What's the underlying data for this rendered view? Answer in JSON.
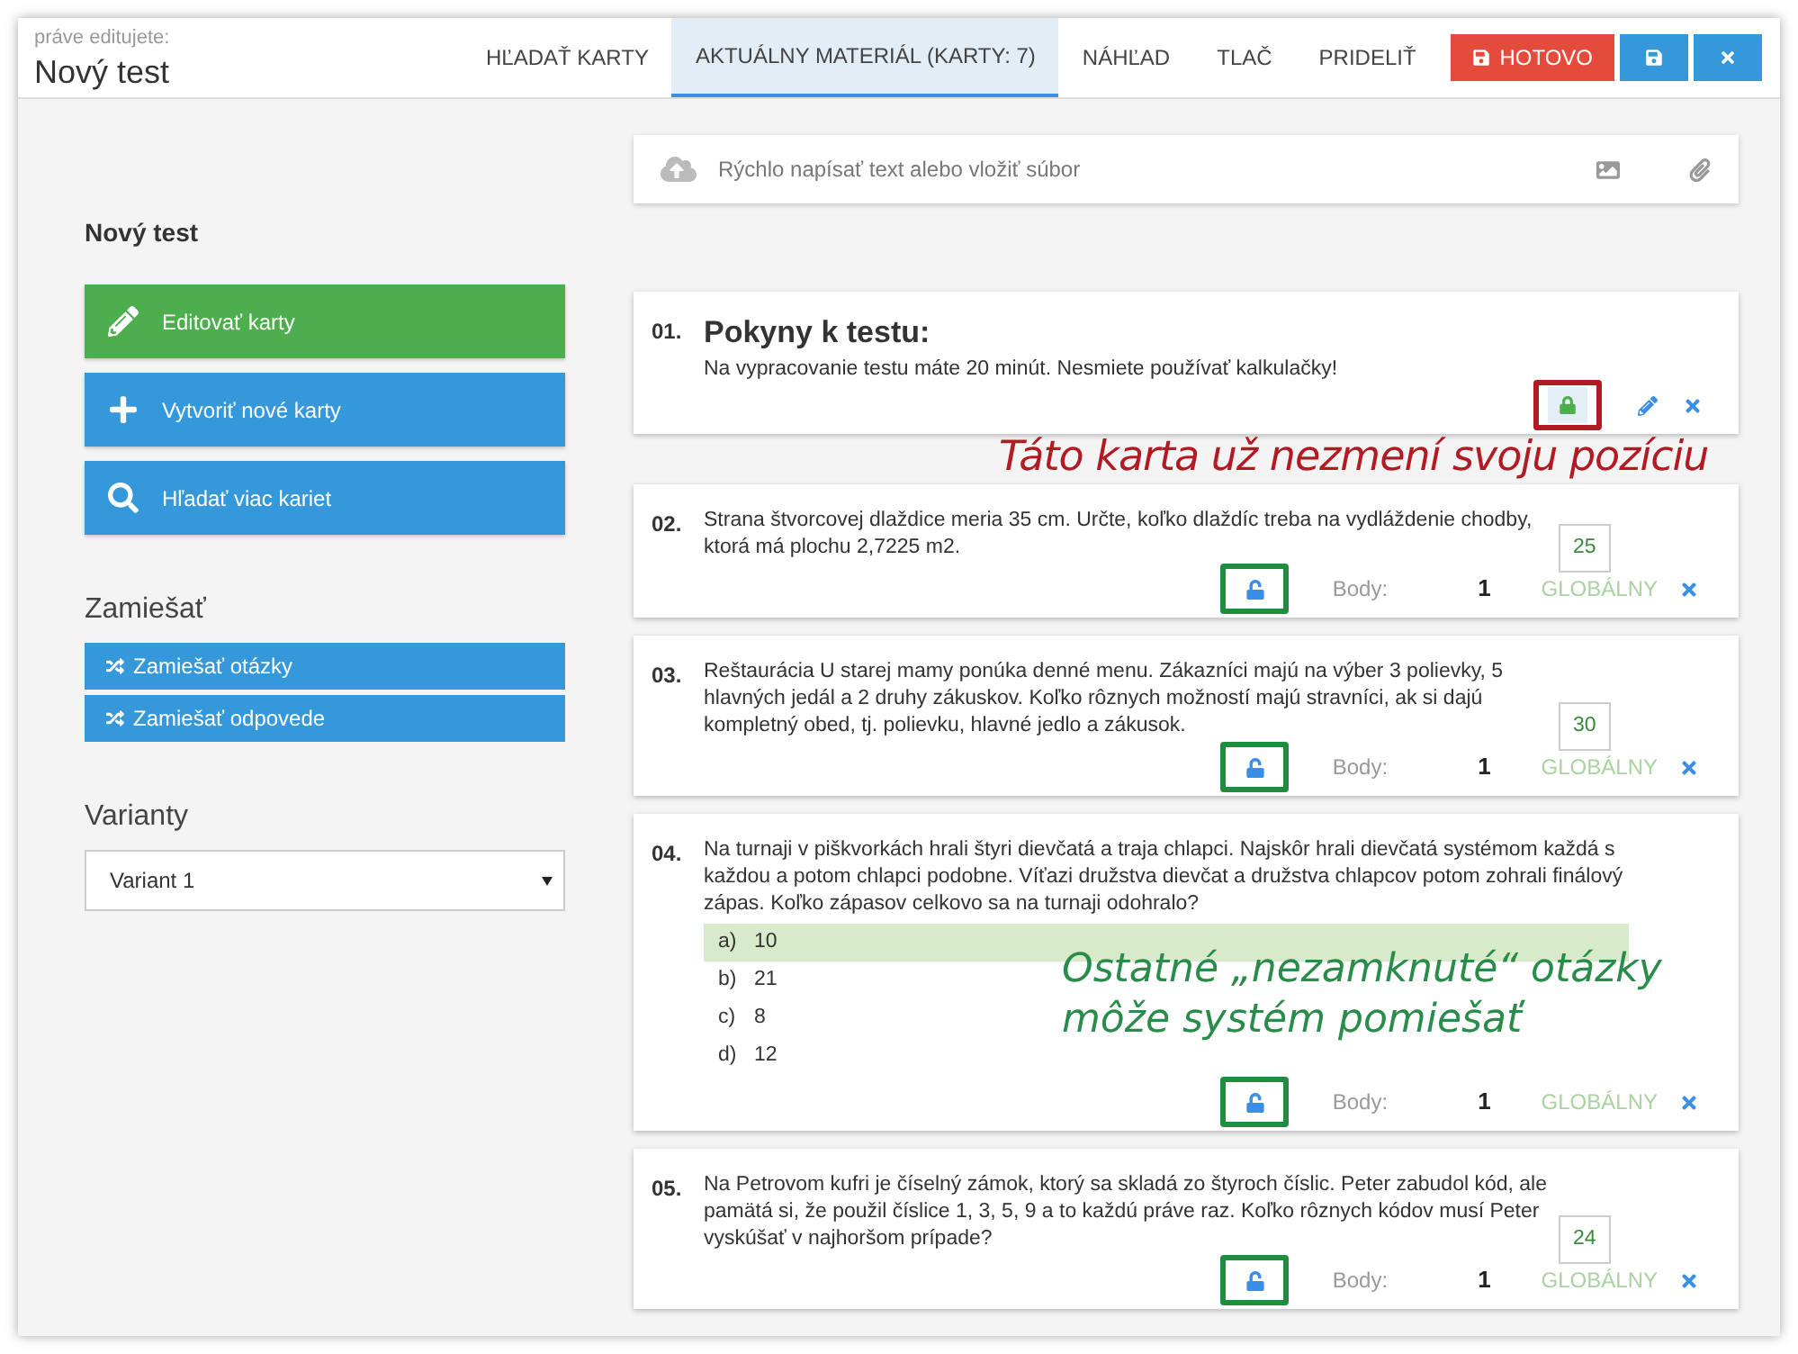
{
  "header": {
    "caption": "práve editujete:",
    "title": "Nový test"
  },
  "tabs": [
    {
      "label": "HĽADAŤ KARTY",
      "selected": false
    },
    {
      "label": "AKTUÁLNY MATERIÁL (KARTY: 7)",
      "selected": true
    },
    {
      "label": "NÁHĽAD",
      "selected": false
    },
    {
      "label": "TLAČ",
      "selected": false
    },
    {
      "label": "PRIDELIŤ",
      "selected": false
    }
  ],
  "done_button": "HOTOVO",
  "sidebar": {
    "title": "Nový test",
    "actions": [
      {
        "label": "Editovať karty",
        "kind": "edit"
      },
      {
        "label": "Vytvoriť nové karty",
        "kind": "create"
      },
      {
        "label": "Hľadať viac kariet",
        "kind": "search"
      }
    ],
    "shuffle_heading": "Zamiešať",
    "shuffle_actions": [
      "Zamiešať otázky",
      "Zamiešať odpovede"
    ],
    "variants_heading": "Varianty",
    "variant": "Variant 1"
  },
  "composer": {
    "placeholder": "Rýchlo napísať text alebo vložiť súbor"
  },
  "cards": [
    {
      "number": "01.",
      "kind": "instruction",
      "title": "Pokyny k testu:",
      "text": "Na vypracovanie testu máte 20 minút. Nesmiete používať kalkulačky!",
      "locked": true
    },
    {
      "number": "02.",
      "kind": "open",
      "text": "Strana štvorcovej dlaždice meria 35 cm. Určte, koľko dlaždíc treba na vydláždenie chodby, ktorá má plochu 2,7225 m2.",
      "answer": "25",
      "locked": false,
      "points_label": "Body:",
      "points": "1",
      "scope": "GLOBÁLNY"
    },
    {
      "number": "03.",
      "kind": "open",
      "text": "Reštaurácia U starej mamy ponúka denné menu. Zákazníci majú na výber 3 polievky, 5 hlavných jedál a 2 druhy zákuskov. Koľko rôznych možností majú stravníci, ak si dajú kompletný obed, tj. polievku, hlavné jedlo a zákusok.",
      "answer": "30",
      "locked": false,
      "points_label": "Body:",
      "points": "1",
      "scope": "GLOBÁLNY"
    },
    {
      "number": "04.",
      "kind": "choice",
      "text": "Na turnaji v piškvorkách hrali štyri dievčatá a traja chlapci. Najskôr hrali dievčatá systémom každá s každou a potom chlapci podobne. Víťazi družstva dievčat  a družstva chlapcov potom zohrali finálový zápas. Koľko zápasov celkovo sa na turnaji odohralo?",
      "options": [
        {
          "label": "a)",
          "text": "10",
          "correct": true
        },
        {
          "label": "b)",
          "text": "21",
          "correct": false
        },
        {
          "label": "c)",
          "text": "8",
          "correct": false
        },
        {
          "label": "d)",
          "text": "12",
          "correct": false
        }
      ],
      "locked": false,
      "points_label": "Body:",
      "points": "1",
      "scope": "GLOBÁLNY"
    },
    {
      "number": "05.",
      "kind": "open",
      "text": "Na Petrovom kufri je číselný zámok, ktorý sa skladá zo štyroch číslic. Peter zabudol kód, ale pamätá si, že použil číslice 1, 3, 5, 9 a to každú práve raz. Koľko rôznych kódov musí Peter vyskúšať v najhoršom prípade?",
      "answer": "24",
      "locked": false,
      "points_label": "Body:",
      "points": "1",
      "scope": "GLOBÁLNY"
    }
  ],
  "annotations": [
    {
      "text": "Táto karta už nezmení svoju pozíciu",
      "color": "#b31b24"
    },
    {
      "text": "Ostatné „nezamknuté“ otázky môže systém pomiešať",
      "color": "#2a8c4a"
    }
  ]
}
